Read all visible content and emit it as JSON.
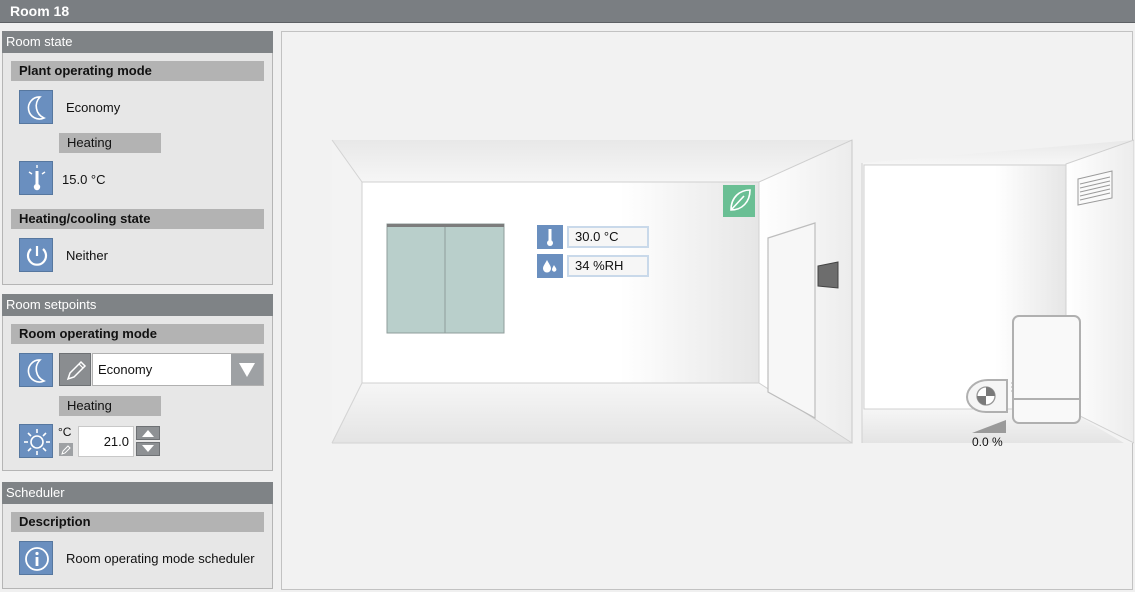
{
  "window": {
    "title": "Room 18"
  },
  "room_state": {
    "header": "Room state",
    "plant_operating_mode": {
      "label": "Plant operating mode",
      "value": "Economy",
      "sub_label": "Heating",
      "temperature": "15.0 °C"
    },
    "heating_cooling_state": {
      "label": "Heating/cooling state",
      "value": "Neither"
    }
  },
  "room_setpoints": {
    "header": "Room setpoints",
    "room_operating_mode": {
      "label": "Room operating mode",
      "selected": "Economy",
      "sub_label": "Heating",
      "unit": "°C",
      "setpoint": "21.0"
    }
  },
  "scheduler": {
    "header": "Scheduler",
    "description_label": "Description",
    "description_value": "Room operating mode scheduler"
  },
  "room_view": {
    "room_temperature": "30.0 °C",
    "room_humidity": "34 %RH",
    "fan_output": "0.0 %"
  },
  "icons": {
    "economy": "moon-icon",
    "temperature": "thermometer-icon",
    "state": "power-icon",
    "edit": "pencil-icon",
    "setpoint": "sun-icon",
    "info": "info-icon",
    "eco_leaf": "leaf-icon",
    "humidity": "water-drops-icon",
    "fan": "fan-icon",
    "vent": "vent-grille-icon"
  },
  "colors": {
    "icon_blue": "#6a8fbf",
    "eco_green": "#6abf94",
    "header_gray": "#7f8386"
  }
}
